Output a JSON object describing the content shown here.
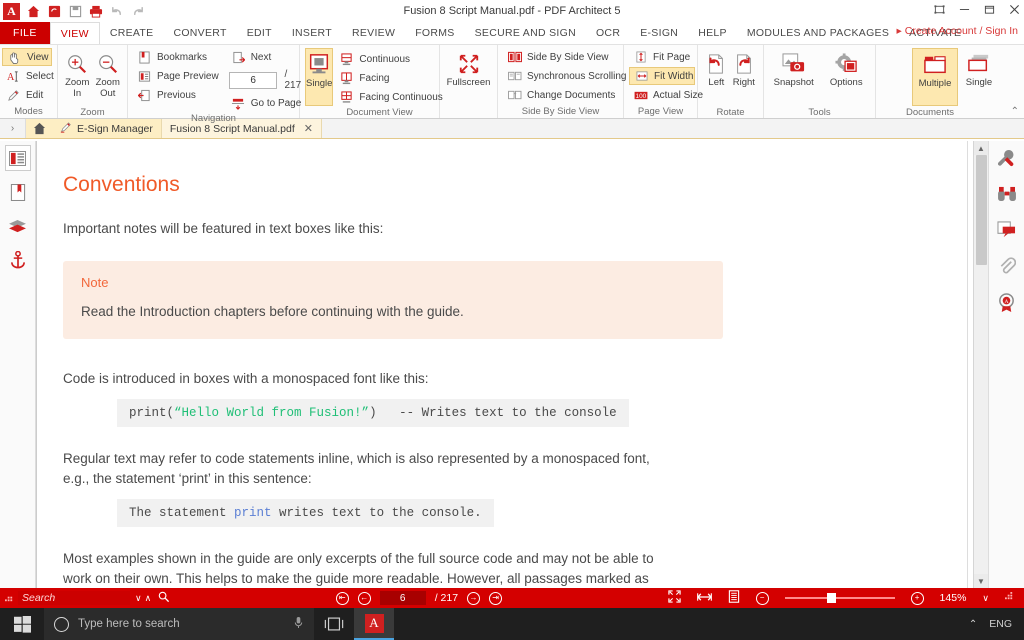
{
  "window": {
    "title": "Fusion 8 Script Manual.pdf  -  PDF Architect 5",
    "restore_icon": "❐",
    "minimize_icon": "–",
    "maximize_icon": "❐",
    "close_icon": "✕"
  },
  "quick_access": {
    "app_letter": "A",
    "items": [
      {
        "name": "home-icon",
        "glyph": "⌂"
      },
      {
        "name": "convert-icon",
        "glyph": "↻"
      },
      {
        "name": "save-icon",
        "glyph": "❐"
      },
      {
        "name": "print-icon",
        "glyph": "⎙"
      },
      {
        "name": "undo-icon",
        "glyph": "↶"
      },
      {
        "name": "redo-icon",
        "glyph": "↷"
      }
    ]
  },
  "ribbon_tabs": {
    "file": "FILE",
    "tabs": [
      "VIEW",
      "CREATE",
      "CONVERT",
      "EDIT",
      "INSERT",
      "REVIEW",
      "FORMS",
      "SECURE AND SIGN",
      "OCR",
      "E-SIGN",
      "HELP",
      "MODULES AND PACKAGES",
      "ACTIVATE"
    ],
    "active": "VIEW",
    "sign_in": "Create Account / Sign In",
    "sign_in_arrow": "▸"
  },
  "ribbon": {
    "collapse_glyph": "⌃",
    "groups": [
      {
        "label": "Modes",
        "items": [
          {
            "name": "mode-view",
            "label": "View",
            "selected": true
          },
          {
            "name": "mode-select",
            "label": "Select",
            "selected": false
          },
          {
            "name": "mode-edit",
            "label": "Edit",
            "selected": false
          }
        ]
      },
      {
        "label": "Zoom",
        "items": [
          {
            "name": "zoom-in-button",
            "label": "Zoom\nIn"
          },
          {
            "name": "zoom-out-button",
            "label": "Zoom\nOut"
          }
        ]
      },
      {
        "label": "Navigation",
        "col1": [
          {
            "name": "bookmarks-button",
            "label": "Bookmarks"
          },
          {
            "name": "page-preview-button",
            "label": "Page Preview"
          },
          {
            "name": "previous-button",
            "label": "Previous"
          }
        ],
        "col2": [
          {
            "name": "next-button",
            "label": "Next"
          },
          {
            "name": "go-to-page-button",
            "label": "Go to Page"
          }
        ],
        "page_value": "6",
        "page_total": "/  217"
      },
      {
        "label": "Document View",
        "big": {
          "name": "single-view-button",
          "label": "Single",
          "selected": true
        },
        "items": [
          {
            "name": "continuous-view",
            "label": "Continuous"
          },
          {
            "name": "facing-view",
            "label": "Facing"
          },
          {
            "name": "facing-continuous-view",
            "label": "Facing Continuous"
          }
        ]
      },
      {
        "label": "",
        "big": {
          "name": "fullscreen-button",
          "label": "Fullscreen",
          "selected": false
        }
      },
      {
        "label": "Side By Side View",
        "items": [
          {
            "name": "side-by-side-view",
            "label": "Side By Side View"
          },
          {
            "name": "synchronous-scrolling",
            "label": "Synchronous Scrolling"
          },
          {
            "name": "change-documents",
            "label": "Change Documents"
          }
        ]
      },
      {
        "label": "Page View",
        "items": [
          {
            "name": "fit-page-button",
            "label": "Fit Page",
            "selected": false
          },
          {
            "name": "fit-width-button",
            "label": "Fit Width",
            "selected": true
          },
          {
            "name": "actual-size-button",
            "label": "Actual Size",
            "selected": false
          }
        ]
      },
      {
        "label": "Rotate",
        "buttons": [
          {
            "name": "rotate-left-button",
            "label": "Left"
          },
          {
            "name": "rotate-right-button",
            "label": "Right"
          }
        ]
      },
      {
        "label": "Tools",
        "buttons": [
          {
            "name": "snapshot-button",
            "label": "Snapshot"
          },
          {
            "name": "options-button",
            "label": "Options"
          }
        ]
      },
      {
        "label": "Documents",
        "buttons": [
          {
            "name": "multiple-documents-button",
            "label": "Multiple",
            "selected": true
          },
          {
            "name": "single-document-button",
            "label": "Single",
            "selected": false
          }
        ]
      }
    ]
  },
  "doc_tabs": {
    "toggle_glyph": "›",
    "home_glyph": "⌂",
    "tabs": [
      {
        "name": "tab-esign-manager",
        "label": "E-Sign Manager",
        "active": false,
        "closable": false
      },
      {
        "name": "tab-fusion-manual",
        "label": "Fusion 8 Script Manual.pdf",
        "active": true,
        "closable": true
      }
    ],
    "close_glyph": "✕"
  },
  "left_rail": [
    {
      "name": "page-thumbnails-icon",
      "boxed": true
    },
    {
      "name": "bookmarks-panel-icon",
      "boxed": false
    },
    {
      "name": "layers-panel-icon",
      "boxed": false
    },
    {
      "name": "attachments-anchor-icon",
      "boxed": false
    }
  ],
  "right_rail": [
    {
      "name": "tools-wrench-icon"
    },
    {
      "name": "search-binoculars-icon"
    },
    {
      "name": "comments-icon"
    },
    {
      "name": "attachment-paperclip-icon"
    },
    {
      "name": "signature-seal-icon"
    }
  ],
  "document": {
    "heading": "Conventions",
    "para1": "Important notes will be featured in text boxes like this:",
    "note": {
      "title": "Note",
      "body": "Read the Introduction chapters before continuing with the guide."
    },
    "para2": "Code is introduced in boxes with a monospaced font like this:",
    "code1": {
      "pre": "print(",
      "string": "“Hello World from Fusion!”",
      "post": ")   -- Writes text to the console"
    },
    "para3_line1": "Regular text may refer to code statements inline, which is also represented by a monospaced font,",
    "para3_line2": "e.g., the statement ‘print’ in this sentence:",
    "code2": {
      "pre": "The statement ",
      "kw": "print",
      "post": " writes text to the console."
    },
    "para4_line1": "Most examples shown in the guide are only excerpts of the full source code and may not be able to",
    "para4_line2": "work on their own. This helps to make the guide more readable. However, all passages marked as"
  },
  "statusbar": {
    "search_placeholder": "Search",
    "search_icon": "⚲",
    "down_glyph": "∨",
    "up_glyph": "∧",
    "first_page_glyph": "⇤",
    "prev_page_glyph": "←",
    "next_page_glyph": "→",
    "last_page_glyph": "⇥",
    "page_value": "6",
    "page_total": "/ 217",
    "fit_page_icon": "fit-page-icon",
    "fit_width_icon": "fit-width-icon",
    "single_page_icon": "single-page-icon",
    "zoom_out_glyph": "−",
    "zoom_in_glyph": "+",
    "zoom_level": "145%",
    "zoom_dropdown_glyph": "∨",
    "grip_glyph": "⋮⋮"
  },
  "taskbar": {
    "start_icon": "windows-logo-icon",
    "search_placeholder": "Type here to search",
    "cortana_icon": "cortana-circle-icon",
    "mic_icon": "ᵕ",
    "taskview_icon": "task-view-icon",
    "app_letter": "A",
    "tray_chevron": "⌃",
    "language": "ENG"
  }
}
